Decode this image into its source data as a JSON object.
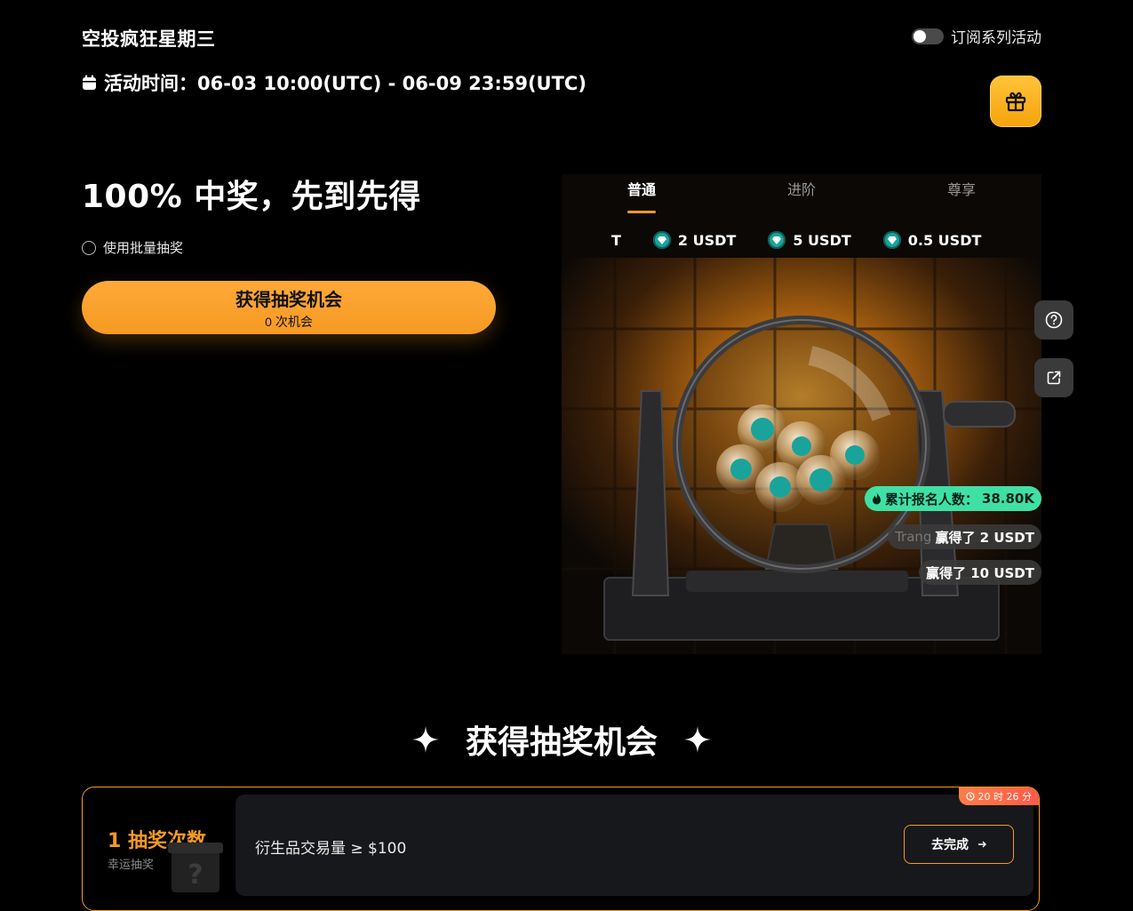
{
  "header": {
    "title": "空投疯狂星期三",
    "subscribe_label": "订阅系列活动",
    "time_label": "活动时间：06-03 10:00(UTC) - 06-09 23:59(UTC)"
  },
  "hero": {
    "headline": "100% 中奖，先到先得",
    "batch_label": "使用批量抽奖",
    "draw_button": "获得抽奖机会",
    "chances": "0 次机会"
  },
  "tabs": [
    {
      "label": "普通",
      "active": true
    },
    {
      "label": "进阶",
      "active": false
    },
    {
      "label": "尊享",
      "active": false
    }
  ],
  "ticker": [
    {
      "label": "T",
      "icon": "gem-icon"
    },
    {
      "label": "2 USDT",
      "icon": "gem-icon"
    },
    {
      "label": "5 USDT",
      "icon": "gem-icon"
    },
    {
      "label": "0.5 USDT",
      "icon": "gem-icon"
    }
  ],
  "stats": {
    "participants_label": "累计报名人数：",
    "participants_value": "38.80K",
    "winners": [
      {
        "user": "Trang",
        "text": "赢得了 2 USDT"
      },
      {
        "user": "",
        "text": "赢得了 10 USDT"
      }
    ]
  },
  "section": {
    "title": "获得抽奖机会"
  },
  "task": {
    "count": "1 抽奖次数",
    "sub": "幸运抽奖",
    "requirement": "衍生品交易量 ≥ $100",
    "button": "去完成",
    "timer": "20 时 26 分"
  },
  "colors": {
    "accent": "#f59a22",
    "gift": "#ffc43a",
    "stat_green": "#3fe0a6",
    "gem": "#1aa39a",
    "timer": "#ff6a47"
  }
}
